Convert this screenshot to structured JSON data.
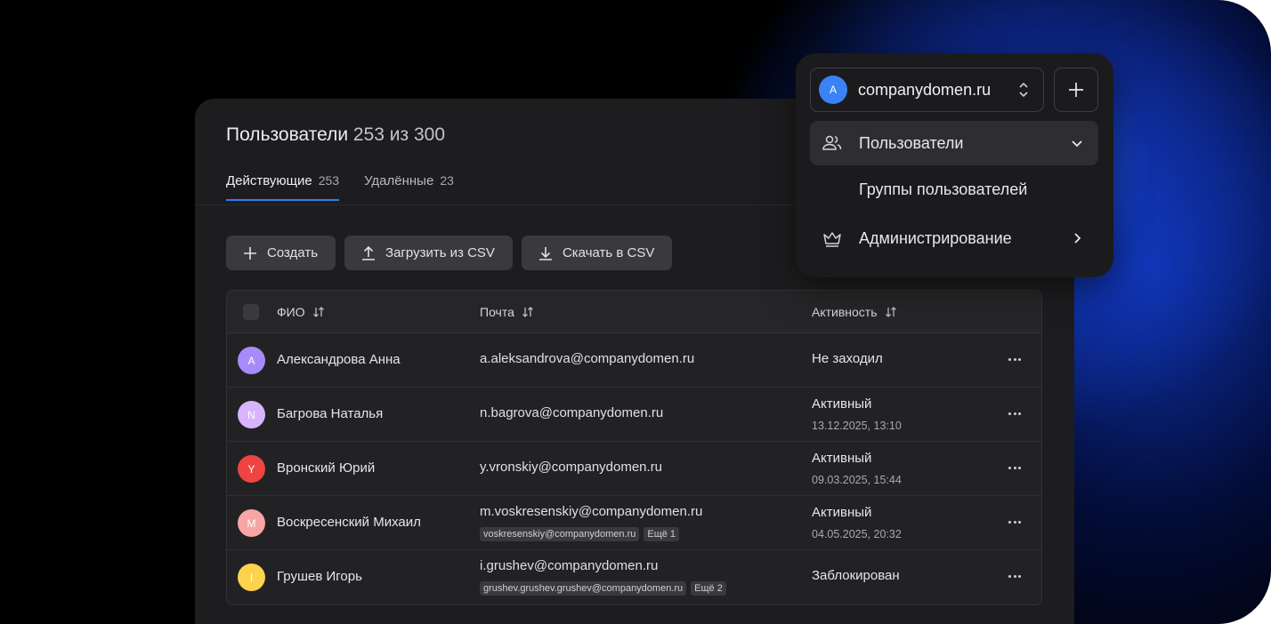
{
  "page": {
    "title": "Пользователи",
    "count": "253 из 300"
  },
  "tabs": [
    {
      "label": "Действующие",
      "count": "253",
      "active": true
    },
    {
      "label": "Удалённые",
      "count": "23",
      "active": false
    }
  ],
  "actions": {
    "create": "Создать",
    "upload": "Загрузить из CSV",
    "download": "Скачать в CSV"
  },
  "table": {
    "columns": {
      "name": "ФИО",
      "mail": "Почта",
      "activity": "Активность"
    },
    "rows": [
      {
        "initial": "A",
        "color": "#a78bfa",
        "name": "Александрова Анна",
        "mail": "a.aleksandrova@companydomen.ru",
        "alias": "",
        "more": "",
        "status": "Не заходил",
        "date": ""
      },
      {
        "initial": "N",
        "color": "#d8b4fe",
        "name": "Багрова Наталья",
        "mail": "n.bagrova@companydomen.ru",
        "alias": "",
        "more": "",
        "status": "Активный",
        "date": "13.12.2025, 13:10"
      },
      {
        "initial": "Y",
        "color": "#ef4444",
        "name": "Вронский Юрий",
        "mail": "y.vronskiy@companydomen.ru",
        "alias": "",
        "more": "",
        "status": "Активный",
        "date": "09.03.2025, 15:44"
      },
      {
        "initial": "M",
        "color": "#f8a5a5",
        "name": "Воскресенский Михаил",
        "mail": "m.voskresenskiy@companydomen.ru",
        "alias": "voskresenskiy@companydomen.ru",
        "more": "Ещё 1",
        "status": "Активный",
        "date": "04.05.2025, 20:32"
      },
      {
        "initial": "I",
        "color": "#fcd34d",
        "name": "Грушев Игорь",
        "mail": "i.grushev@companydomen.ru",
        "alias": "grushev.grushev.grushev@companydomen.ru",
        "more": "Ещё 2",
        "status": "Заблокирован",
        "date": ""
      }
    ]
  },
  "menu": {
    "org_initial": "A",
    "org_name": "companydomen.ru",
    "items": [
      {
        "label": "Пользователи",
        "icon": "users-icon"
      },
      {
        "label": "Группы пользователей"
      },
      {
        "label": "Администрирование",
        "icon": "crown-icon"
      }
    ]
  }
}
